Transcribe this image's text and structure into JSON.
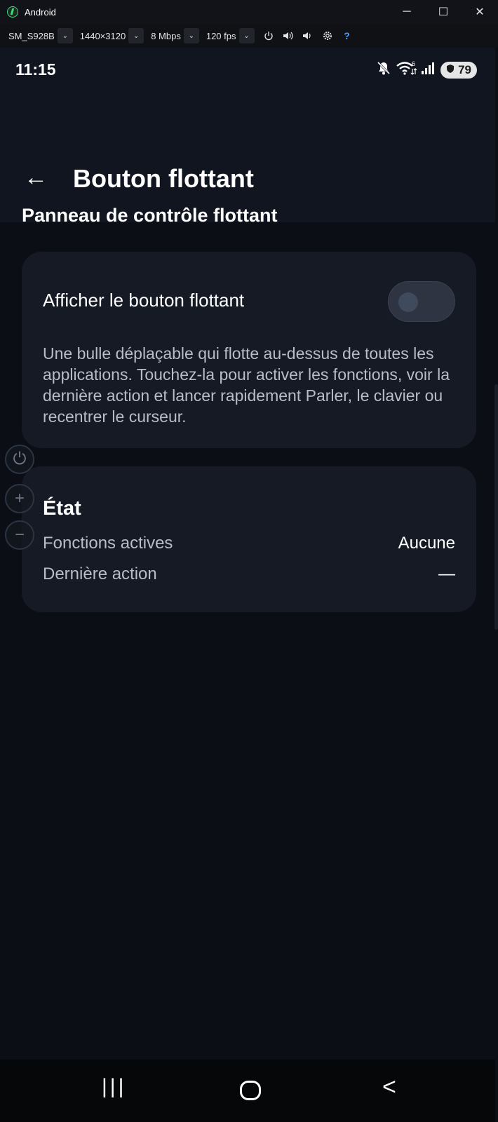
{
  "window": {
    "title": "Android",
    "minimize_glyph": "─",
    "maximize_glyph": "☐",
    "close_glyph": "✕"
  },
  "toolbar": {
    "device": "SM_S928B",
    "resolution": "1440×3120",
    "bitrate": "8 Mbps",
    "fps": "120 fps",
    "dropdown_glyph": "⌄",
    "icons": [
      "power-icon",
      "volume-up-icon",
      "volume-down-icon",
      "settings-icon",
      "help-icon"
    ],
    "help_glyph": "?"
  },
  "statusbar": {
    "time": "11:15",
    "battery": "79",
    "wifi_badge": "6",
    "icons": [
      "mute-icon",
      "wifi-icon",
      "signal-icon",
      "battery-icon"
    ]
  },
  "appbar": {
    "back_glyph": "←",
    "title": "Bouton flottant"
  },
  "main": {
    "section_title": "Panneau de contrôle flottant",
    "toggle_card": {
      "label": "Afficher le bouton flottant",
      "toggle_on": false,
      "description": "Une bulle déplaçable qui flotte au-dessus de toutes les applications. Touchez-la pour activer les fonctions, voir la dernière action et lancer rapidement Parler, le clavier ou recentrer le curseur."
    },
    "state_card": {
      "title": "État",
      "rows": [
        {
          "key": "Fonctions actives",
          "value": "Aucune"
        },
        {
          "key": "Dernière action",
          "value": "—"
        }
      ]
    }
  },
  "side_controls": {
    "power_glyph": "⏻",
    "plus_glyph": "+",
    "minus_glyph": "−"
  },
  "navbar": {
    "recent_glyph": "|||",
    "back_glyph": "<"
  },
  "colors": {
    "background": "#0b0e14",
    "card": "#151a24",
    "appbar": "#111520",
    "text_primary": "#ffffff",
    "text_secondary": "#b8bdc8"
  }
}
